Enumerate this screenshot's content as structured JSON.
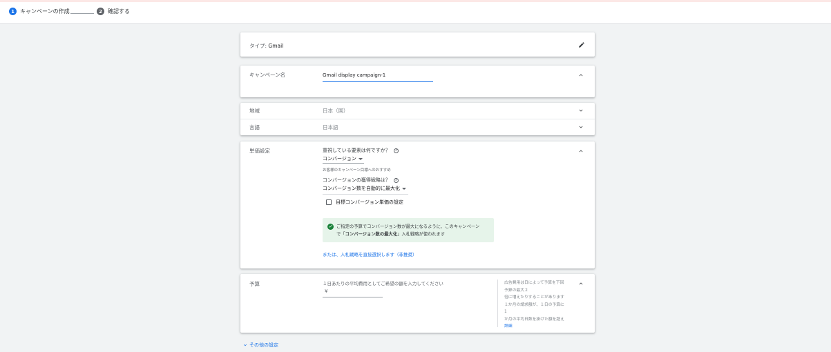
{
  "stepper": {
    "step1": {
      "num": "1",
      "label": "キャンペーンの作成"
    },
    "step2": {
      "num": "2",
      "label": "確認する"
    }
  },
  "type_card": {
    "label": "タイプ: ",
    "value": "Gmail"
  },
  "name_card": {
    "label": "キャンペーン名",
    "value": "Gmail display campaign-1"
  },
  "location": {
    "label": "地域",
    "value": "日本（国）"
  },
  "language": {
    "label": "言語",
    "value": "日本語"
  },
  "bidding": {
    "label": "単価設定",
    "focus_question": "重視している要素は何ですか？",
    "focus_value": "コンバージョン",
    "recommend_note": "お客様のキャンペーン目標へのおすすめ",
    "strategy_question": "コンバージョンの獲得戦略は？",
    "strategy_value": "コンバージョン数を自動的に最大化",
    "target_cpa_label": "目標コンバージョン単価の設定",
    "info_text_1": "ご指定の予算でコンバージョン数が最大になるように、このキャンペーン",
    "info_text_2a": "で「",
    "info_bold": "コンバージョン数の最大化",
    "info_text_2b": "」入札戦略が使われます",
    "manual_link": "または、入札戦略を直接選択します（非推奨）"
  },
  "budget": {
    "label": "予算",
    "prompt": "１日あたりの平均費用としてご希望の額を入力してください",
    "currency": "¥",
    "side_lines": [
      "広告費用は日によって予算を下回",
      "予算の最大２",
      "倍に増えたりすることがあります",
      "１か月の請求額が、１日の予算に",
      "1",
      "か月の平均日数を掛けた額を超え"
    ],
    "details_link": "詳細"
  },
  "other_settings_link": "その他の設定",
  "colors": {
    "accent": "#1a73e8",
    "success": "#188038",
    "info_bg": "#e6f4ea"
  }
}
